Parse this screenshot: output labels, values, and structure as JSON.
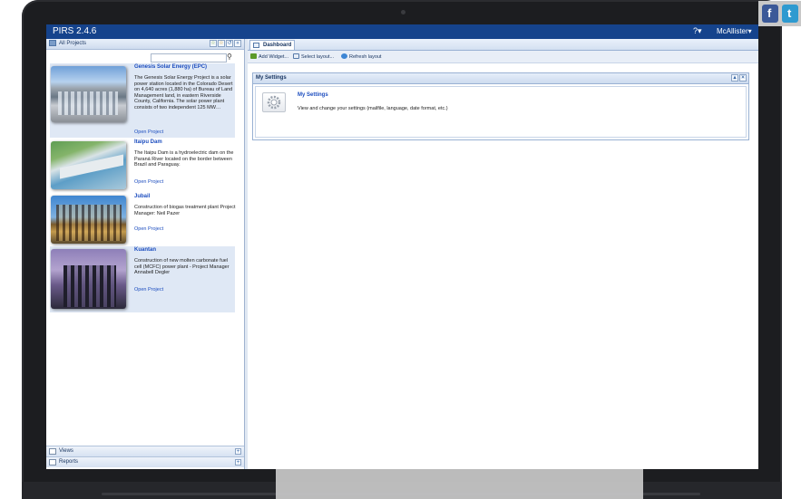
{
  "app": {
    "title": "PIRS 2.4.6",
    "help_icon": "?▾",
    "user": "McAllister▾"
  },
  "left_panel": {
    "header": "All Projects",
    "projects": [
      {
        "title": "Genesis Solar Energy (EPC)",
        "desc": "The Genesis Solar Energy Project is a solar power station located in the Colorado Desert on 4,640 acres (1,880 ha) of Bureau of Land Management land, in eastern Riverside County, California. The solar power plant consists of two independent 125 MW…",
        "open": "Open Project"
      },
      {
        "title": "Itaipu Dam",
        "desc": "The Itaipu Dam is a hydroelectric dam on the Paraná River located on the border between Brazil and Paraguay.",
        "open": "Open Project"
      },
      {
        "title": "Jubail",
        "desc": "Construction of biogas treatment plant Project Manager: Neil Pazer",
        "open": "Open Project"
      },
      {
        "title": "Kuantan",
        "desc": "Construction of new molten carbonate fuel cell (MCFC) power plant - Project Manager Annabell Degler",
        "open": "Open Project"
      }
    ],
    "accordion": {
      "views": "Views",
      "reports": "Reports"
    }
  },
  "main": {
    "tab": "Dashboard",
    "toolbar": {
      "add_widget": "Add Widget...",
      "select_layout": "Select layout...",
      "refresh_layout": "Refresh layout"
    },
    "widget": {
      "title": "My Settings",
      "link": "My Settings",
      "desc": "View and change your settings (mailfile, language, date format, etc.)"
    }
  },
  "social": {
    "facebook": "f",
    "twitter": "t"
  },
  "colors": {
    "titlebar": "#15438c",
    "link": "#1c4dbf",
    "selected_row": "#dfe8f5"
  }
}
